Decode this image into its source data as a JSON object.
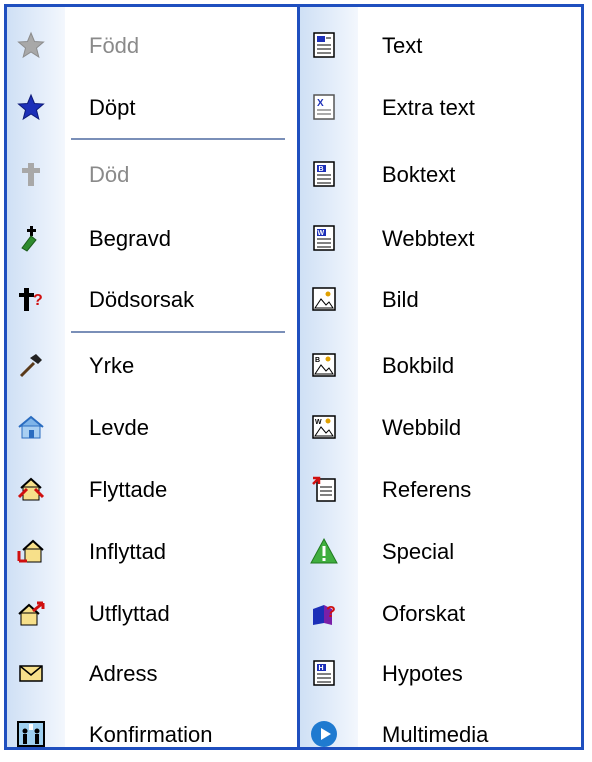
{
  "left_menu": {
    "items": [
      {
        "label": "Född",
        "icon": "star-gray-icon",
        "enabled": false
      },
      {
        "label": "Döpt",
        "icon": "star-blue-icon",
        "enabled": true
      },
      {
        "label": "Död",
        "icon": "cross-gray-icon",
        "enabled": false
      },
      {
        "label": "Begravd",
        "icon": "burial-icon",
        "enabled": true
      },
      {
        "label": "Dödsorsak",
        "icon": "cross-question-icon",
        "enabled": true
      },
      {
        "label": "Yrke",
        "icon": "hammer-icon",
        "enabled": true
      },
      {
        "label": "Levde",
        "icon": "house-blue-icon",
        "enabled": true
      },
      {
        "label": "Flyttade",
        "icon": "house-move-icon",
        "enabled": true
      },
      {
        "label": "Inflyttad",
        "icon": "house-in-icon",
        "enabled": true
      },
      {
        "label": "Utflyttad",
        "icon": "house-out-icon",
        "enabled": true
      },
      {
        "label": "Adress",
        "icon": "envelope-icon",
        "enabled": true
      },
      {
        "label": "Konfirmation",
        "icon": "confirmation-icon",
        "enabled": true
      }
    ]
  },
  "right_menu": {
    "items": [
      {
        "label": "Text",
        "icon": "text-doc-icon"
      },
      {
        "label": "Extra text",
        "icon": "extra-text-icon"
      },
      {
        "label": "Boktext",
        "icon": "book-text-icon"
      },
      {
        "label": "Webbtext",
        "icon": "web-text-icon"
      },
      {
        "label": "Bild",
        "icon": "picture-icon"
      },
      {
        "label": "Bokbild",
        "icon": "book-picture-icon"
      },
      {
        "label": "Webbild",
        "icon": "web-picture-icon"
      },
      {
        "label": "Referens",
        "icon": "reference-icon"
      },
      {
        "label": "Special",
        "icon": "warning-triangle-icon"
      },
      {
        "label": "Oforskat",
        "icon": "unresearched-icon"
      },
      {
        "label": "Hypotes",
        "icon": "hypothesis-icon"
      },
      {
        "label": "Multimedia",
        "icon": "play-circle-icon"
      }
    ]
  },
  "colors": {
    "frame_border": "#1f4fbf",
    "disabled_text": "#8a8a8a",
    "separator": "#7a8fb8"
  }
}
